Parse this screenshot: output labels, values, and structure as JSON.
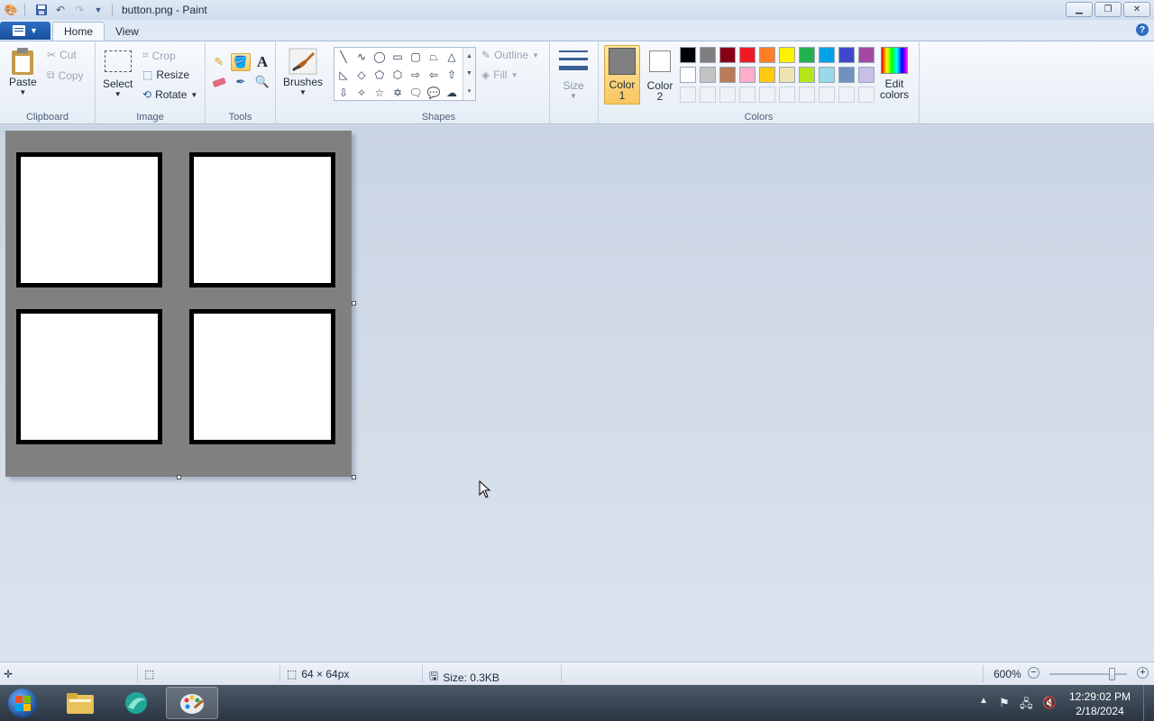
{
  "window": {
    "title": "button.png - Paint"
  },
  "tabs": [
    {
      "label": "Home"
    },
    {
      "label": "View"
    }
  ],
  "clipboard": {
    "paste": "Paste",
    "cut": "Cut",
    "copy": "Copy",
    "label": "Clipboard"
  },
  "image": {
    "select": "Select",
    "crop": "Crop",
    "resize": "Resize",
    "rotate": "Rotate",
    "label": "Image"
  },
  "tools": {
    "label": "Tools",
    "selected": "fill-tool"
  },
  "brushes": {
    "label": "Brushes"
  },
  "shapes": {
    "label": "Shapes",
    "outline": "Outline",
    "fill": "Fill"
  },
  "size": {
    "label": "Size"
  },
  "colors": {
    "color1_line1": "Color",
    "color1_line2": "1",
    "color2_line1": "Color",
    "color2_line2": "2",
    "edit_line1": "Edit",
    "edit_line2": "colors",
    "label": "Colors",
    "color1_value": "#7f7f7f",
    "color2_value": "#ffffff",
    "row1": [
      "#000000",
      "#7f7f7f",
      "#880015",
      "#ed1c24",
      "#ff7f27",
      "#fff200",
      "#22b14c",
      "#00a2e8",
      "#3f48cc",
      "#a349a4"
    ],
    "row2": [
      "#ffffff",
      "#c3c3c3",
      "#b97a57",
      "#ffaec9",
      "#ffc90e",
      "#efe4b0",
      "#b5e61d",
      "#99d9ea",
      "#7092be",
      "#c8bfe7"
    ]
  },
  "status": {
    "dimensions": "64 × 64px",
    "size": "Size: 0.3KB",
    "zoom": "600%",
    "zoom_level": 0.8
  },
  "taskbar": {
    "time": "12:29:02 PM",
    "date": "2/18/2024"
  }
}
